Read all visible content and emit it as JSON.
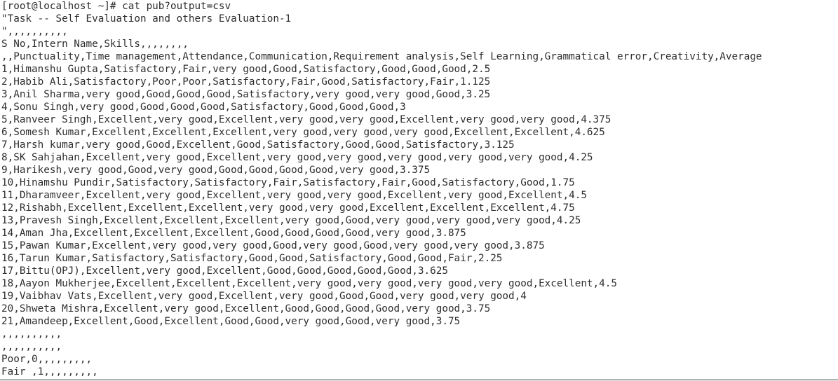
{
  "terminal": {
    "lines": [
      "[root@localhost ~]# cat pub?output=csv",
      "\"Task -- Self Evaluation and others Evaluation-1",
      "\",,,,,,,,,,",
      "S No,Intern Name,Skills,,,,,,,,",
      ",,Punctuality,Time management,Attendance,Communication,Requirement analysis,Self Learning,Grammatical error,Creativity,Average",
      "1,Himanshu Gupta,Satisfactory,Fair,very good,Good,Satisfactory,Good,Good,Good,2.5",
      "2,Habib Ali,Satisfactory,Poor,Poor,Satisfactory,Fair,Good,Satisfactory,Fair,1.125",
      "3,Anil Sharma,very good,Good,Good,Good,Satisfactory,very good,very good,Good,3.25",
      "4,Sonu Singh,very good,Good,Good,Good,Satisfactory,Good,Good,Good,3",
      "5,Ranveer Singh,Excellent,very good,Excellent,very good,very good,Excellent,very good,very good,4.375",
      "6,Somesh Kumar,Excellent,Excellent,Excellent,very good,very good,very good,Excellent,Excellent,4.625",
      "7,Harsh kumar,very good,Good,Excellent,Good,Satisfactory,Good,Good,Satisfactory,3.125",
      "8,SK Sahjahan,Excellent,very good,Excellent,very good,very good,very good,very good,very good,4.25",
      "9,Harikesh,very good,Good,very good,Good,Good,Good,Good,very good,3.375",
      "10,Hinamshu Pundir,Satisfactory,Satisfactory,Fair,Satisfactory,Fair,Good,Satisfactory,Good,1.75",
      "11,Dharamveer,Excellent,very good,Excellent,very good,very good,Excellent,very good,Excellent,4.5",
      "12,Rishabh,Excellent,Excellent,Excellent,very good,very good,Excellent,Excellent,Excellent,4.75",
      "13,Pravesh Singh,Excellent,Excellent,Excellent,very good,Good,very good,very good,very good,4.25",
      "14,Aman Jha,Excellent,Excellent,Excellent,Good,Good,Good,Good,very good,3.875",
      "15,Pawan Kumar,Excellent,very good,very good,Good,very good,Good,very good,very good,3.875",
      "16,Tarun Kumar,Satisfactory,Satisfactory,Good,Good,Satisfactory,Good,Good,Fair,2.25",
      "17,Bittu(OPJ),Excellent,very good,Excellent,Good,Good,Good,Good,Good,3.625",
      "18,Aayon Mukherjee,Excellent,Excellent,Excellent,very good,very good,very good,very good,Excellent,4.5",
      "19,Vaibhav Vats,Excellent,very good,Excellent,very good,Good,Good,very good,very good,4",
      "20,Shweta Mishra,Excellent,very good,Excellent,Good,Good,Good,Good,very good,3.75",
      "21,Amandeep,Excellent,Good,Excellent,Good,Good,very good,Good,very good,3.75",
      ",,,,,,,,,,",
      ",,,,,,,,,,",
      "Poor,0,,,,,,,,,",
      "Fair ,1,,,,,,,,,"
    ]
  }
}
